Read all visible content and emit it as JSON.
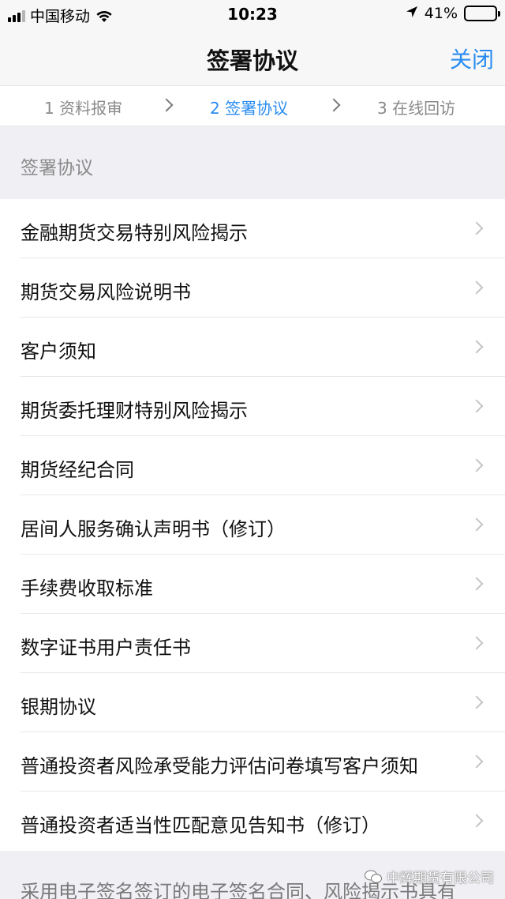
{
  "status_bar": {
    "carrier": "中国移动",
    "time": "10:23",
    "battery_percent": "41%",
    "battery_level": 0.41,
    "signal_bars": 3,
    "icons": [
      "signal-icon",
      "wifi-icon",
      "location-arrow-icon",
      "battery-icon"
    ]
  },
  "nav": {
    "title": "签署协议",
    "close_label": "关闭"
  },
  "steps": [
    {
      "label": "1 资料报审",
      "active": false
    },
    {
      "label": "2 签署协议",
      "active": true
    },
    {
      "label": "3 在线回访",
      "active": false
    }
  ],
  "section": {
    "header": "签署协议",
    "items": [
      "金融期货交易特别风险揭示",
      "期货交易风险说明书",
      "客户须知",
      "期货委托理财特别风险揭示",
      "期货经纪合同",
      "居间人服务确认声明书（修订）",
      "手续费收取标准",
      "数字证书用户责任书",
      "银期协议",
      "普通投资者风险承受能力评估问卷填写客户须知",
      "普通投资者适当性匹配意见告知书（修订）"
    ]
  },
  "footer": {
    "text": "采用电子签名签订的电子签名合同、风险揭示书具有",
    "watermark": "中辉期货有限公司"
  },
  "colors": {
    "accent": "#2a8cf0",
    "background_gray": "#efeff4",
    "bar_gray": "#f7f7f7"
  }
}
